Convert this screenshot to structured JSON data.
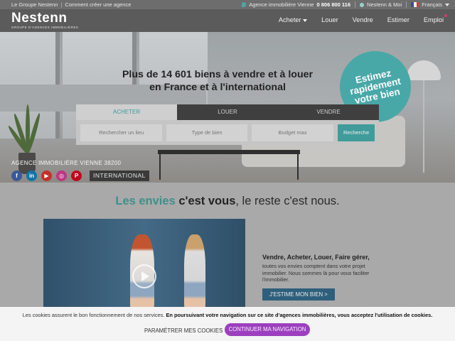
{
  "topbar": {
    "left_links": [
      "Le Groupe Nestenn",
      "Comment créer une agence"
    ],
    "agency_label": "Agence immobilière Vienne",
    "phone": "0 806 800 116",
    "account_link": "Nestenn & Moi",
    "language": "Français"
  },
  "header": {
    "logo_name": "Nestenn",
    "logo_subtitle": "GROUPE D'AGENCES IMMOBILIÈRES",
    "nav": [
      "Acheter",
      "Louer",
      "Vendre",
      "Estimer",
      "Emploi"
    ]
  },
  "hero": {
    "headline_line1": "Plus de 14 601 biens à vendre et à louer",
    "headline_line2": "en France et à l'international",
    "estimez_lines": [
      "Estimez",
      "rapidement",
      "votre bien"
    ],
    "search": {
      "tabs": [
        "ACHETER",
        "LOUER",
        "VENDRE"
      ],
      "active_tab": "ACHETER",
      "location_placeholder": "Rechercher un lieu",
      "type_placeholder": "Type de bien",
      "budget_placeholder": "Budget max",
      "submit_label": "Recherche"
    },
    "agency_name": "AGENCE IMMOBILIÈRE VIENNE 38200",
    "socials": [
      "f",
      "in",
      "▶",
      "◎",
      "P"
    ],
    "international_label": "INTERNATIONAL"
  },
  "section": {
    "tagline_part1": "Les envies",
    "tagline_part2": "c'est vous",
    "tagline_part3": ", le reste c'est nous.",
    "promo_title": "Vendre, Acheter, Louer, Faire gérer,",
    "promo_text": "toutes vos envies comptent dans votre projet immobilier. Nous sommes là pour vous faciliter l'immobilier.",
    "promo_button": "J'ESTIME MON BIEN >"
  },
  "cookie": {
    "text_normal": "Les cookies assurent le bon fonctionnement de nos services. ",
    "text_bold": "En poursuivant votre navigation sur ce site d'agences immobilières, vous acceptez l'utilisation de cookies.",
    "params_label": "PARAMÉTRER MES COOKIES",
    "continue_label": "CONTINUER MA NAVIGATION"
  },
  "colors": {
    "brand_teal": "#3f9c9a",
    "cookie_purple": "#9c3fbf",
    "promo_button": "#2e5f7c",
    "social_facebook": "#3b5998",
    "social_linkedin": "#0e76a8",
    "social_youtube": "#c4302b",
    "social_instagram": "#c13584",
    "social_pinterest": "#bd081c"
  },
  "icons": [
    "map-pin-icon",
    "user-icon",
    "french-flag-icon",
    "chevron-down-icon",
    "play-icon",
    "facebook-icon",
    "linkedin-icon",
    "youtube-icon",
    "instagram-icon",
    "pinterest-icon"
  ]
}
